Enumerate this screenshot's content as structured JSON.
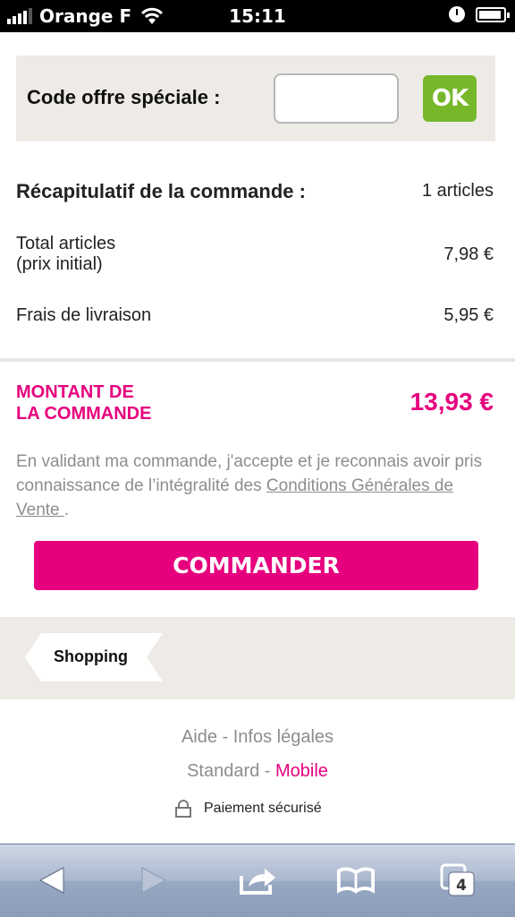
{
  "status_bar": {
    "carrier": "Orange F",
    "time": "15:11"
  },
  "promo": {
    "label": "Code offre spéciale :",
    "input_value": "",
    "ok_label": "OK",
    "ok_color": "#76b82a"
  },
  "summary": {
    "title": "Récapitulatif de la commande :",
    "count": "1 articles",
    "rows": [
      {
        "label_line1": "Total articles",
        "label_line2": "(prix initial)",
        "value": "7,98 €"
      },
      {
        "label_line1": "Frais de livraison",
        "label_line2": "",
        "value": "5,95 €"
      }
    ]
  },
  "total": {
    "label_line1": "MONTANT DE",
    "label_line2": "LA COMMANDE",
    "value": "13,93 €",
    "color": "#e6007e"
  },
  "legal": {
    "text_before": "En validant ma commande, j'accepte et je reconnais avoir pris connaissance de l’intégralité des ",
    "link_text": "Conditions Générales de Vente ",
    "text_after": "."
  },
  "order_button": {
    "label": "COMMANDER"
  },
  "back_tag": {
    "label": "Shopping"
  },
  "footer": {
    "help": "Aide",
    "separator": " - ",
    "legal_info": "Infos légales",
    "standard": "Standard",
    "mobile": "Mobile",
    "secure": "Paiement sécurisé"
  },
  "toolbar": {
    "icons": [
      "back-icon",
      "forward-icon",
      "share-icon",
      "bookmarks-icon",
      "tabs-icon"
    ],
    "tabs_count": "4"
  }
}
